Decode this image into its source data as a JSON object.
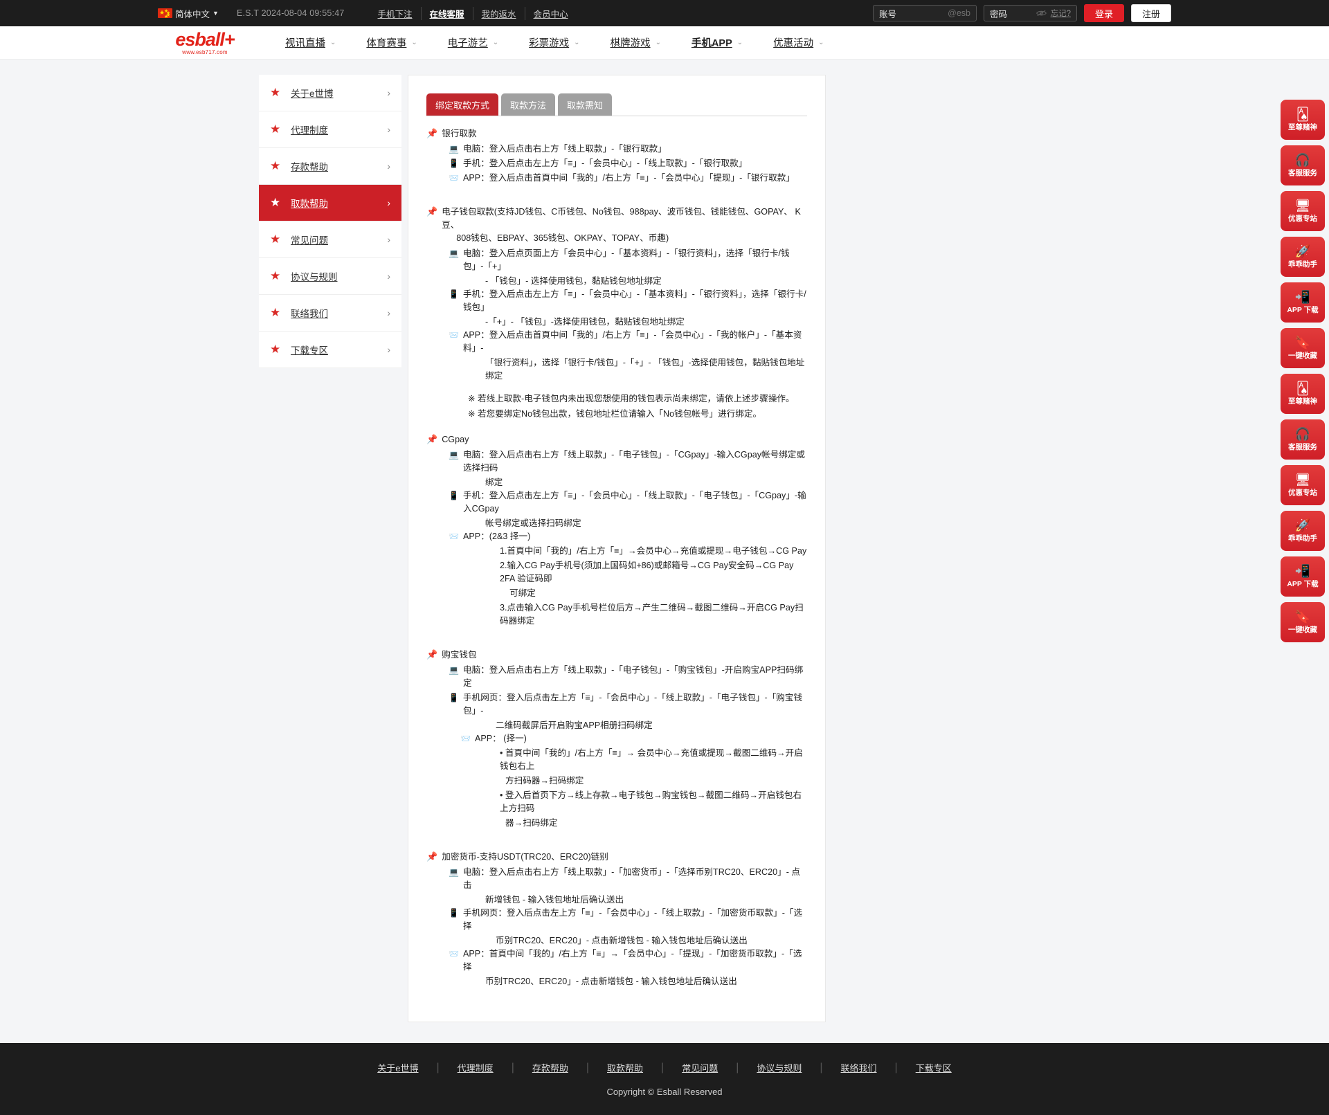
{
  "topbar": {
    "language": "简体中文",
    "caret": "▼",
    "clock": "E.S.T 2024-08-04 09:55:47",
    "links": [
      {
        "label": "手机下注",
        "strong": false
      },
      {
        "label": "在线客服",
        "strong": true
      },
      {
        "label": "我的返水",
        "strong": false
      },
      {
        "label": "会员中心",
        "strong": false
      }
    ],
    "account": {
      "label": "账号",
      "placeholder": "@esb"
    },
    "password": {
      "label": "密码",
      "forgot": "忘记?"
    },
    "login_button": "登录",
    "register_button": "注册"
  },
  "brand": {
    "name": "esball+",
    "url": "www.esb717.com"
  },
  "nav": {
    "items": [
      {
        "label": "视讯直播",
        "bold": false
      },
      {
        "label": "体育赛事",
        "bold": false
      },
      {
        "label": "电子游艺",
        "bold": false
      },
      {
        "label": "彩票游戏",
        "bold": false
      },
      {
        "label": "棋牌游戏",
        "bold": false
      },
      {
        "label": "手机APP",
        "bold": true
      },
      {
        "label": "优惠活动",
        "bold": false
      }
    ]
  },
  "sidebar": {
    "items": [
      {
        "label": "关于e世博",
        "active": false
      },
      {
        "label": "代理制度",
        "active": false
      },
      {
        "label": "存款帮助",
        "active": false
      },
      {
        "label": "取款帮助",
        "active": true
      },
      {
        "label": "常见问题",
        "active": false
      },
      {
        "label": "协议与规则",
        "active": false
      },
      {
        "label": "联络我们",
        "active": false
      },
      {
        "label": "下载专区",
        "active": false
      }
    ]
  },
  "tabs": [
    {
      "label": "绑定取款方式",
      "active": true
    },
    {
      "label": "取款方法",
      "active": false
    },
    {
      "label": "取款需知",
      "active": false
    }
  ],
  "sections": {
    "bank": {
      "title": "银行取款",
      "pc_label": "电脑：",
      "pc_text": "登入后点击右上方「线上取款」-「银行取款」",
      "mobile_label": "手机：",
      "mobile_text": "登入后点击左上方「≡」-「会员中心」-「线上取款」-「银行取款」",
      "app_label": "APP：",
      "app_text": "登入后点击首頁中间「我的」/右上方「≡」-「会员中心」「提现」-「银行取款」"
    },
    "ewallet": {
      "title_line1": "电子钱包取款(支持JD钱包、C币钱包、No钱包、988pay、波币钱包、钱能钱包、GOPAY、 K豆、",
      "title_line2": "808钱包、EBPAY、365钱包、OKPAY、TOPAY、币趣)",
      "pc_label": "电脑：",
      "pc_text": "登入后点页面上方「会员中心」-「基本资料」-「银行资料」，选择「银行卡/钱包」-「+」",
      "pc_text2": "- 「钱包」- 选择使用钱包，黏贴钱包地址绑定",
      "mobile_label": "手机：",
      "mobile_text": "登入后点击左上方「≡」-「会员中心」-「基本资料」-「银行资料」，选择「银行卡/钱包」",
      "mobile_text2": "-「+」- 「钱包」-选择使用钱包，黏贴钱包地址绑定",
      "app_label": "APP：",
      "app_text": "登入后点击首頁中间「我的」/右上方「≡」-「会员中心」-「我的帐户」-「基本资料」-",
      "app_text2": "「银行资料」，选择「银行卡/钱包」-「+」- 「钱包」-选择使用钱包，黏贴钱包地址绑定",
      "note1": "※ 若线上取款-电子钱包内未出现您想使用的钱包表示尚未绑定，请依上述步骤操作。",
      "note2": "※ 若您要绑定No钱包出款，钱包地址栏位请输入「No钱包帐号」进行绑定。"
    },
    "cgpay": {
      "title": "CGpay",
      "pc_label": "电脑：",
      "pc_text": "登入后点击右上方「线上取款」-「电子钱包」-「CGpay」-输入CGpay帐号绑定或选择扫码",
      "pc_text2": "绑定",
      "mobile_label": "手机：",
      "mobile_text": "登入后点击左上方「≡」-「会员中心」-「线上取款」-「电子钱包」-「CGpay」-输入CGpay",
      "mobile_text2": "帐号绑定或选择扫码绑定",
      "app_label": "APP：",
      "app_text": "(2&3 择一)",
      "step1": "1.首頁中间「我的」/右上方「≡」→会员中心→充值或提现→电子钱包→CG Pay",
      "step2": "2.输入CG Pay手机号(须加上国码如+86)或邮箱号→CG Pay安全码→CG Pay 2FA 验证码即",
      "step2b": "可绑定",
      "step3": "3.点击输入CG Pay手机号栏位后方→产生二维码→截图二维码→开启CG Pay扫码器绑定"
    },
    "goubao": {
      "title": "购宝钱包",
      "pc_label": "电脑：",
      "pc_text": "登入后点击右上方「线上取款」-「电子钱包」-「购宝钱包」-开启购宝APP扫码绑定",
      "mobile_label": "手机网页：",
      "mobile_text": "登入后点击左上方「≡」-「会员中心」-「线上取款」-「电子钱包」-「购宝钱包」-",
      "mobile_text2": "二维码截屏后开启购宝APP相册扫码绑定",
      "app_label": "APP：",
      "app_text": "(择一)",
      "b1": "• 首頁中间「我的」/右上方「≡」→ 会员中心→充值或提现→截图二维码→开启钱包右上",
      "b1b": "方扫码器→扫码绑定",
      "b2": "• 登入后首页下方→线上存款→电子钱包→购宝钱包→截图二维码→开启钱包右上方扫码",
      "b2b": "器→扫码绑定"
    },
    "crypto": {
      "title": "加密货币-支持USDT(TRC20、ERC20)链别",
      "pc_label": "电脑：",
      "pc_text": "登入后点击右上方「线上取款」-「加密货币」-「选择币别TRC20、ERC20」- 点击",
      "pc_text2": "新增钱包 - 输入钱包地址后确认送出",
      "mobile_label": "手机网页：",
      "mobile_text": "登入后点击左上方「≡」-「会员中心」-「线上取款」-「加密货币取款」-「选择",
      "mobile_text2": "币别TRC20、ERC20」- 点击新增钱包 - 输入钱包地址后确认送出",
      "app_label": "APP：",
      "app_text": "首頁中间「我的」/右上方「≡」→「会员中心」-「提现」-「加密货币取款」-「选择",
      "app_text2": "币别TRC20、ERC20」- 点击新增钱包 - 输入钱包地址后确认送出"
    }
  },
  "rail": [
    {
      "name": "至尊赌神",
      "icon": "cards-icon",
      "glyph": "🂡"
    },
    {
      "name": "客服服务",
      "icon": "headset-icon",
      "glyph": "🎧"
    },
    {
      "name": "优惠专站",
      "icon": "monitor-icon",
      "glyph": "🖥"
    },
    {
      "name": "乖乖助手",
      "icon": "rocket-icon",
      "glyph": "🚀"
    },
    {
      "name": "APP 下载",
      "icon": "phone-download-icon",
      "glyph": "📲"
    },
    {
      "name": "一键收藏",
      "icon": "bookmark-star-icon",
      "glyph": "🔖"
    },
    {
      "name": "至尊赌神",
      "icon": "cards-icon",
      "glyph": "🂡"
    },
    {
      "name": "客服服务",
      "icon": "headset-icon",
      "glyph": "🎧"
    },
    {
      "name": "优惠专站",
      "icon": "monitor-icon",
      "glyph": "🖥"
    },
    {
      "name": "乖乖助手",
      "icon": "rocket-icon",
      "glyph": "🚀"
    },
    {
      "name": "APP 下载",
      "icon": "phone-download-icon",
      "glyph": "📲"
    },
    {
      "name": "一键收藏",
      "icon": "bookmark-star-icon",
      "glyph": "🔖"
    }
  ],
  "footer": {
    "links": [
      "关于e世博",
      "代理制度",
      "存款帮助",
      "取款帮助",
      "常见问题",
      "协议与规则",
      "联络我们",
      "下载专区"
    ],
    "copyright": "Copyright © Esball Reserved"
  },
  "colors": {
    "brand_red": "#e2231a",
    "active_red": "#cc2027",
    "tab_gray": "#a0a0a0"
  }
}
